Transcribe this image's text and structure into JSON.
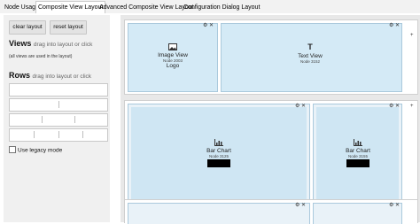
{
  "tabs": [
    "Node Usage",
    "Composite View Layout",
    "Advanced Composite View Layout",
    "Configuration Dialog Layout"
  ],
  "left": {
    "buttons": {
      "clear": "clear layout",
      "reset": "reset layout"
    },
    "views": {
      "title": "Views",
      "hint": "drag into layout or click",
      "note": "(all views are used in the layout)"
    },
    "rows": {
      "title": "Rows",
      "hint": "drag into layout or click"
    },
    "legacy_label": "Use legacy mode"
  },
  "layout": {
    "views": {
      "image": {
        "title": "Image View",
        "node": "Node 2003",
        "sub": "Logo"
      },
      "text": {
        "title": "Text View",
        "node": "Node 3152"
      },
      "bar1": {
        "title": "Bar Chart",
        "node": "Node 3125"
      },
      "bar2": {
        "title": "Bar Chart",
        "node": "Node 3155"
      }
    },
    "row_controls": "⚙ ✕",
    "plus": "+"
  }
}
